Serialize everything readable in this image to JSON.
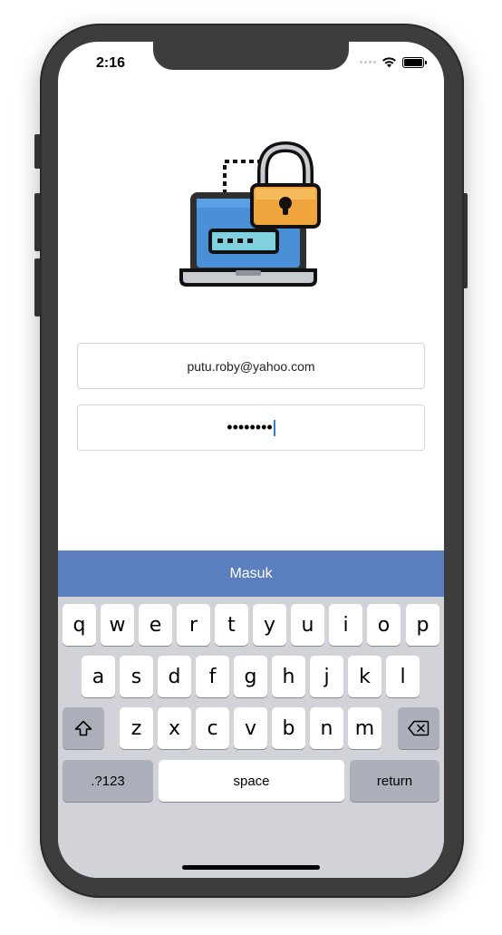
{
  "status_bar": {
    "time": "2:16"
  },
  "login": {
    "email_value": "putu.roby@yahoo.com",
    "password_masked": "••••••••",
    "submit_label": "Masuk"
  },
  "keyboard": {
    "row1": [
      "q",
      "w",
      "e",
      "r",
      "t",
      "y",
      "u",
      "i",
      "o",
      "p"
    ],
    "row2": [
      "a",
      "s",
      "d",
      "f",
      "g",
      "h",
      "j",
      "k",
      "l"
    ],
    "row3": [
      "z",
      "x",
      "c",
      "v",
      "b",
      "n",
      "m"
    ],
    "numbers_label": ".?123",
    "space_label": "space",
    "return_label": "return",
    "shift_icon": "shift-icon",
    "delete_icon": "backspace-icon"
  },
  "colors": {
    "button_bg": "#5b7fbf",
    "keyboard_bg": "#d1d3d9",
    "caret": "#3478f6",
    "lock_orange": "#f0a43c",
    "laptop_blue": "#4a90d9"
  }
}
